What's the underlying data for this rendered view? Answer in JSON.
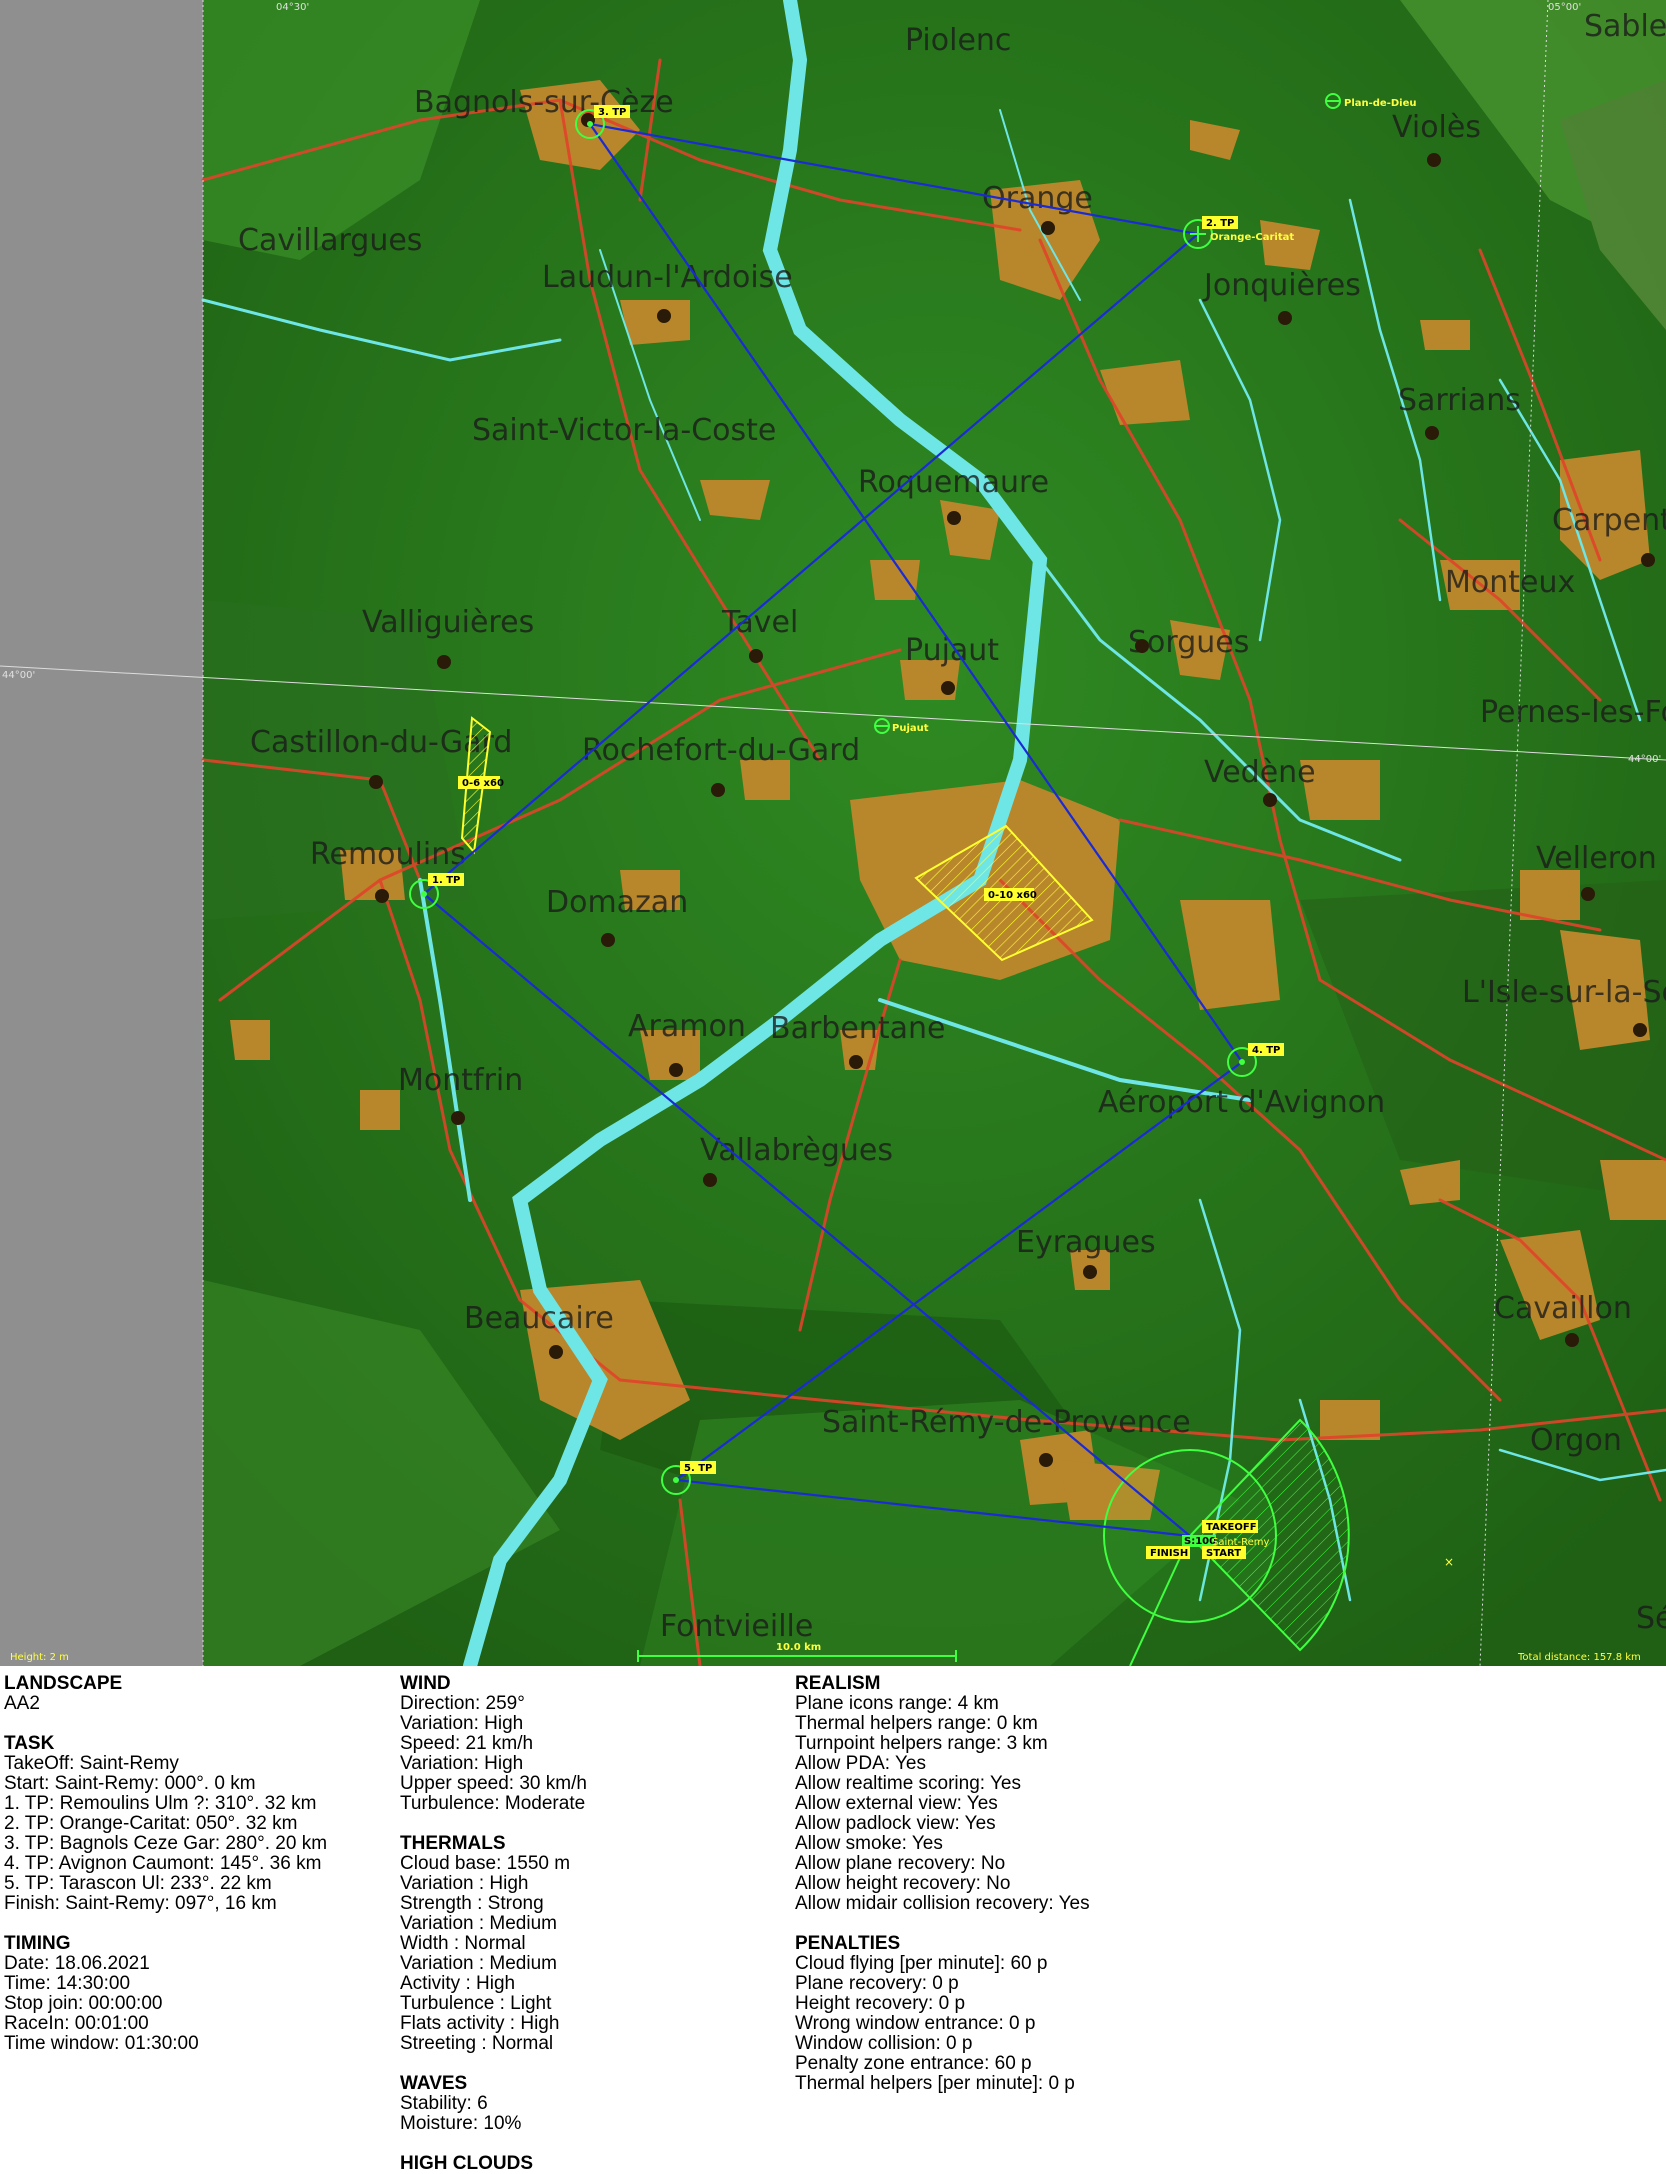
{
  "map": {
    "height_label": "Height: 2 m",
    "total_distance": "Total distance: 157.8 km",
    "scale_label": "10.0 km",
    "grid": {
      "lon_left": "04°30'",
      "lon_right": "05°00'",
      "lat_mid": "44°00'",
      "lat_right": "44°00'"
    },
    "towns": [
      "Bagnols-sur-Cèze",
      "Piolenc",
      "Orange",
      "Violès",
      "Cavillargues",
      "Laudun-l'Ardoise",
      "Jonquières",
      "Saint-Victor-la-Coste",
      "Roquemaure",
      "Sarrians",
      "Carpentras",
      "Valliguières",
      "Tavel",
      "Pujaut",
      "Sorgues",
      "Monteux",
      "Castillon-du-Gard",
      "Rochefort-du-Gard",
      "Vedène",
      "Pernes-les-Fontaines",
      "Remoulins",
      "Domazan",
      "Velleron",
      "Aramon",
      "Barbentane",
      "L'Isle-sur-la-Sorgue",
      "Montfrin",
      "Aéroport d'Avignon",
      "Vallabrègues",
      "Eyragues",
      "Beaucaire",
      "Cavaillon",
      "Saint-Rémy-de-Provence",
      "Orgon",
      "Fontvieille",
      "Sablet",
      "Sénas"
    ],
    "airfields": [
      "Plan-de-Dieu",
      "Pujaut",
      "Orange-Caritat"
    ],
    "turnpoints": [
      {
        "id": "1. TP"
      },
      {
        "id": "2. TP",
        "name": "Orange-Caritat"
      },
      {
        "id": "3. TP"
      },
      {
        "id": "4. TP"
      },
      {
        "id": "5. TP"
      }
    ],
    "start_labels": {
      "takeoff": "TAKEOFF",
      "start": "START",
      "finish": "FINISH",
      "site": "Saint-Remy",
      "sector": "S:100"
    },
    "zones": [
      {
        "label": "0-6 x60"
      },
      {
        "label": "0-10 x60"
      }
    ]
  },
  "landscape": {
    "title": "LANDSCAPE",
    "name": "AA2"
  },
  "task": {
    "title": "TASK",
    "lines": [
      "TakeOff: Saint-Remy",
      "Start: Saint-Remy: 000°. 0 km",
      "1. TP: Remoulins Ulm ?: 310°. 32 km",
      "2. TP: Orange-Caritat: 050°. 32 km",
      "3. TP: Bagnols Ceze Gar: 280°. 20 km",
      "4. TP: Avignon Caumont: 145°. 36 km",
      "5. TP: Tarascon Ul: 233°. 22 km",
      "Finish: Saint-Remy: 097°, 16 km"
    ]
  },
  "timing": {
    "title": "TIMING",
    "lines": [
      "Date: 18.06.2021",
      "Time: 14:30:00",
      "Stop join: 00:00:00",
      "RaceIn: 00:01:00",
      "Time window: 01:30:00"
    ]
  },
  "wind": {
    "title": "WIND",
    "lines": [
      "Direction: 259°",
      "Variation: High",
      "Speed: 21 km/h",
      "Variation: High",
      "Upper speed: 30 km/h",
      "Turbulence: Moderate"
    ]
  },
  "thermals": {
    "title": "THERMALS",
    "lines": [
      "Cloud base: 1550 m",
      "Variation : High",
      "Strength : Strong",
      "Variation : Medium",
      "Width : Normal",
      "Variation : Medium",
      "Activity : High",
      "Turbulence : Light",
      "Flats activity : High",
      "Streeting : Normal"
    ]
  },
  "waves": {
    "title": "WAVES",
    "lines": [
      "Stability: 6",
      "Moisture: 10%"
    ]
  },
  "high_clouds": {
    "title": "HIGH CLOUDS"
  },
  "realism": {
    "title": "REALISM",
    "lines": [
      "Plane icons range: 4 km",
      "Thermal helpers range: 0 km",
      "Turnpoint helpers range: 3 km",
      "Allow PDA: Yes",
      "Allow realtime scoring: Yes",
      "Allow external view: Yes",
      "Allow padlock view: Yes",
      "Allow smoke: Yes",
      "Allow plane recovery: No",
      "Allow height recovery: No",
      "Allow midair collision recovery: Yes"
    ]
  },
  "penalties": {
    "title": "PENALTIES",
    "lines": [
      "Cloud flying [per minute]: 60 p",
      "Plane recovery: 0 p",
      "Height recovery: 0 p",
      "Wrong window entrance: 0 p",
      "Window collision: 0 p",
      "Penalty zone entrance: 60 p",
      "Thermal helpers [per minute]: 0 p"
    ]
  },
  "colors": {
    "terrain": "#2c7a1f",
    "urban": "#b8862b",
    "road": "#e0442a",
    "river": "#6fe6e6",
    "route": "#1a2bd6",
    "tp": "#40ff40",
    "zone": "#ffff30"
  }
}
